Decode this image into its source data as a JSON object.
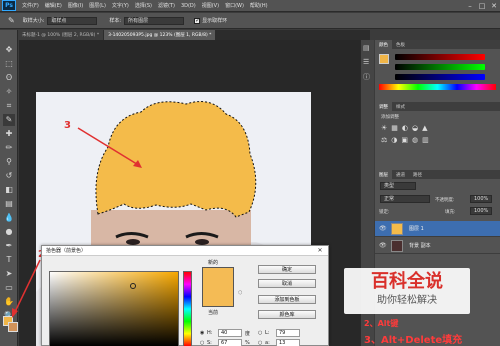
{
  "app": {
    "logo": "Ps"
  },
  "menubar": {
    "items": [
      "文件(F)",
      "编辑(E)",
      "图像(I)",
      "图层(L)",
      "文字(Y)",
      "选择(S)",
      "滤镜(T)",
      "3D(D)",
      "视图(V)",
      "窗口(W)",
      "帮助(H)"
    ],
    "min": "–",
    "max": "□",
    "close": "✕"
  },
  "options": {
    "sample_size_label": "取样大小:",
    "sample_size_value": "取样点",
    "sample_label": "样本:",
    "sample_value": "所有图层",
    "show_ring_label": "显示取样环"
  },
  "tabs": [
    {
      "label": "未标题-1 @ 100% (图层 2, RGB/8) *",
      "active": false
    },
    {
      "label": "3-140205093P5.jpg @ 123% (图层 1, RGB/8) *",
      "active": true
    }
  ],
  "panels": {
    "color_tabs": [
      "颜色",
      "色板"
    ],
    "adjust_tabs": [
      "调整",
      "样式"
    ],
    "adjust_add": "添加调整",
    "layer_tabs": [
      "图层",
      "通道",
      "路径"
    ],
    "kind_label": "类型",
    "blend_mode": "正常",
    "opacity_label": "不透明度:",
    "opacity_value": "100%",
    "lock_label": "锁定:",
    "fill_label": "填充:",
    "fill_value": "100%",
    "layers": [
      {
        "name": "图层 1",
        "selected": true
      },
      {
        "name": "背景 副本",
        "selected": false
      }
    ]
  },
  "dialog": {
    "title": "拾色器（前景色）",
    "close": "✕",
    "new_label": "新的",
    "current_label": "当前",
    "buttons": [
      "确定",
      "取消",
      "添加到色板",
      "颜色库"
    ],
    "fields": [
      {
        "label": "H:",
        "value": "40",
        "unit": "度"
      },
      {
        "label": "S:",
        "value": "67",
        "unit": "%"
      }
    ],
    "lab_fields": [
      {
        "label": "L:",
        "value": "79"
      },
      {
        "label": "a:",
        "value": "13"
      }
    ],
    "new_color": "#f4bb55"
  },
  "annotations": {
    "num2": "2",
    "num3": "3",
    "note1": "2、Alt键",
    "note2": "3、Alt+Delete填充"
  },
  "watermark": {
    "title": "百科全说",
    "subtitle": "助你轻松解决"
  },
  "colors": {
    "fill": "#f4bb4a",
    "fg": "#f0b548",
    "bg": "#d1935a",
    "selection": "#3d6eb0",
    "annotation": "#ff3b3b"
  }
}
